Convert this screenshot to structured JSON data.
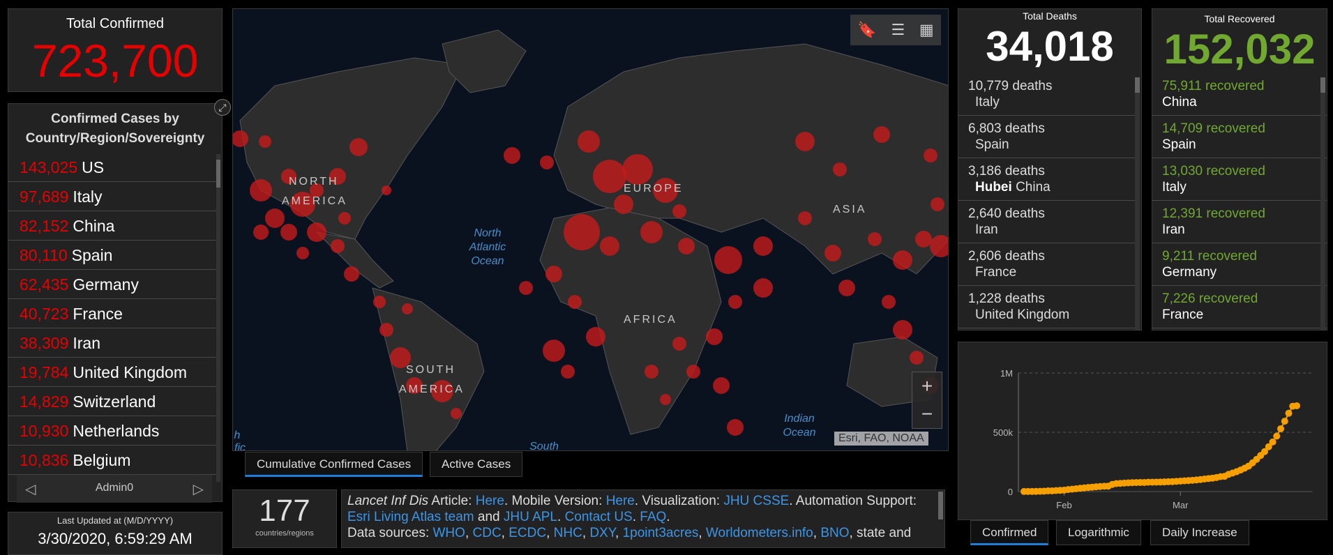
{
  "total_confirmed": {
    "title": "Total Confirmed",
    "value": "723,700"
  },
  "country_panel": {
    "title": "Confirmed Cases by Country/Region/Sovereignty",
    "nav_label": "Admin0",
    "rows": [
      {
        "count": "143,025",
        "name": "US"
      },
      {
        "count": "97,689",
        "name": "Italy"
      },
      {
        "count": "82,152",
        "name": "China"
      },
      {
        "count": "80,110",
        "name": "Spain"
      },
      {
        "count": "62,435",
        "name": "Germany"
      },
      {
        "count": "40,723",
        "name": "France"
      },
      {
        "count": "38,309",
        "name": "Iran"
      },
      {
        "count": "19,784",
        "name": "United Kingdom"
      },
      {
        "count": "14,829",
        "name": "Switzerland"
      },
      {
        "count": "10,930",
        "name": "Netherlands"
      },
      {
        "count": "10,836",
        "name": "Belgium"
      }
    ]
  },
  "last_updated": {
    "title": "Last Updated at (M/D/YYYY)",
    "value": "3/30/2020, 6:59:29 AM"
  },
  "map": {
    "labels": {
      "north_america_1": "NORTH",
      "north_america_2": "AMERICA",
      "europe": "EUROPE",
      "asia": "ASIA",
      "africa": "AFRICA",
      "south_america_1": "SOUTH",
      "south_america_2": "AMERICA",
      "north_atlantic_1": "North",
      "north_atlantic_2": "Atlantic",
      "north_atlantic_3": "Ocean",
      "indian_1": "Indian",
      "indian_2": "Ocean",
      "south": "South",
      "edge_1": "h",
      "edge_2": "fic"
    },
    "attribution": "Esri, FAO, NOAA",
    "colors": {
      "ocean": "#0a1220",
      "land": "#2d2d2d",
      "bubble": "#c41a1a"
    }
  },
  "map_tabs": [
    "Cumulative Confirmed Cases",
    "Active Cases"
  ],
  "countries_count": {
    "value": "177",
    "label": "countries/regions"
  },
  "info": {
    "line1_a": "Lancet Inf Dis",
    "line1_b": " Article: ",
    "here1": "Here",
    "line1_c": ". Mobile Version: ",
    "here2": "Here",
    "line1_d": ". Visualization: ",
    "jhu": "JHU CSSE",
    "line1_e": ". Automation Support:",
    "esri": "Esri Living Atlas team",
    "and": " and ",
    "apl": "JHU APL",
    "dot": ". ",
    "contact": "Contact US",
    "dot2": ". ",
    "faq": "FAQ",
    "dot3": ".",
    "sources_prefix": "Data sources: ",
    "sources": [
      "WHO",
      "CDC",
      "ECDC",
      "NHC",
      "DXY",
      "1point3acres",
      "Worldometers.info",
      "BNO"
    ],
    "sources_suffix": ", state and"
  },
  "deaths": {
    "title": "Total Deaths",
    "value": "34,018",
    "color": "#ffffff",
    "rows": [
      {
        "count": "10,779",
        "unit": "deaths",
        "place": "Italy",
        "bold": ""
      },
      {
        "count": "6,803",
        "unit": "deaths",
        "place": "Spain",
        "bold": ""
      },
      {
        "count": "3,186",
        "unit": "deaths",
        "place": "China",
        "bold": "Hubei"
      },
      {
        "count": "2,640",
        "unit": "deaths",
        "place": "Iran",
        "bold": ""
      },
      {
        "count": "2,606",
        "unit": "deaths",
        "place": "France",
        "bold": ""
      },
      {
        "count": "1,228",
        "unit": "deaths",
        "place": "United Kingdom",
        "bold": ""
      }
    ]
  },
  "recovered": {
    "title": "Total Recovered",
    "value": "152,032",
    "color": "#70a830",
    "rows": [
      {
        "count": "75,911",
        "unit": "recovered",
        "place": "China"
      },
      {
        "count": "14,709",
        "unit": "recovered",
        "place": "Spain"
      },
      {
        "count": "13,030",
        "unit": "recovered",
        "place": "Italy"
      },
      {
        "count": "12,391",
        "unit": "recovered",
        "place": "Iran"
      },
      {
        "count": "9,211",
        "unit": "recovered",
        "place": "Germany"
      },
      {
        "count": "7,226",
        "unit": "recovered",
        "place": "France"
      }
    ]
  },
  "chart_tabs": [
    "Confirmed",
    "Logarithmic",
    "Daily Increase"
  ],
  "chart_data": {
    "type": "line",
    "title": "",
    "xlabel": "",
    "ylabel": "",
    "yticks": [
      "1M",
      "500k",
      "0"
    ],
    "xticks": [
      "Feb",
      "Mar"
    ],
    "ylim": [
      0,
      1000000
    ],
    "x": [
      "2020-01-22",
      "2020-01-23",
      "2020-01-24",
      "2020-01-25",
      "2020-01-26",
      "2020-01-27",
      "2020-01-28",
      "2020-01-29",
      "2020-01-30",
      "2020-01-31",
      "2020-02-01",
      "2020-02-02",
      "2020-02-03",
      "2020-02-04",
      "2020-02-05",
      "2020-02-06",
      "2020-02-07",
      "2020-02-08",
      "2020-02-09",
      "2020-02-10",
      "2020-02-11",
      "2020-02-12",
      "2020-02-13",
      "2020-02-14",
      "2020-02-15",
      "2020-02-16",
      "2020-02-17",
      "2020-02-18",
      "2020-02-19",
      "2020-02-20",
      "2020-02-21",
      "2020-02-22",
      "2020-02-23",
      "2020-02-24",
      "2020-02-25",
      "2020-02-26",
      "2020-02-27",
      "2020-02-28",
      "2020-02-29",
      "2020-03-01",
      "2020-03-02",
      "2020-03-03",
      "2020-03-04",
      "2020-03-05",
      "2020-03-06",
      "2020-03-07",
      "2020-03-08",
      "2020-03-09",
      "2020-03-10",
      "2020-03-11",
      "2020-03-12",
      "2020-03-13",
      "2020-03-14",
      "2020-03-15",
      "2020-03-16",
      "2020-03-17",
      "2020-03-18",
      "2020-03-19",
      "2020-03-20",
      "2020-03-21",
      "2020-03-22",
      "2020-03-23",
      "2020-03-24",
      "2020-03-25",
      "2020-03-26",
      "2020-03-27",
      "2020-03-28",
      "2020-03-29",
      "2020-03-30"
    ],
    "series": [
      {
        "color": "#f5a000",
        "values": [
          555,
          654,
          941,
          1434,
          2118,
          2927,
          5578,
          6166,
          8234,
          9927,
          12038,
          16787,
          19881,
          23892,
          27635,
          30794,
          34391,
          37120,
          40150,
          42762,
          44802,
          45221,
          60368,
          66885,
          69030,
          71224,
          73258,
          75136,
          75639,
          76197,
          76819,
          78572,
          78958,
          79561,
          80406,
          81388,
          82746,
          84112,
          86011,
          88369,
          90306,
          92840,
          95120,
          97886,
          101801,
          105847,
          109821,
          113590,
          118620,
          125875,
          128343,
          145193,
          156097,
          167449,
          181546,
          197168,
          214915,
          242713,
          272167,
          304528,
          336953,
          378235,
          418045,
          467653,
          529591,
          593291,
          660706,
          720117,
          723700
        ]
      }
    ]
  }
}
